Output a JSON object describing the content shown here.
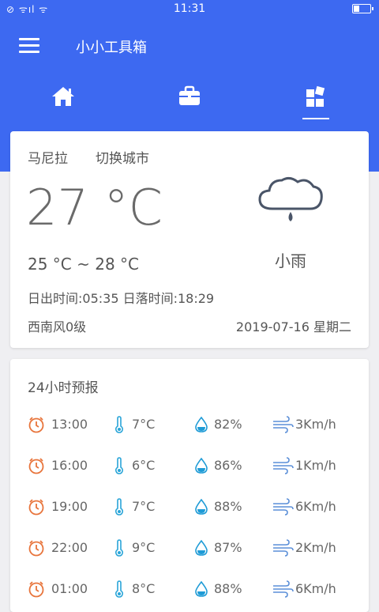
{
  "status_bar": {
    "time": "11:31",
    "left_icons": "⊘ ᯤıl ᯤ"
  },
  "app": {
    "title": "小小工具箱"
  },
  "tabs": [
    {
      "name": "home",
      "icon": "home-icon",
      "selected": false
    },
    {
      "name": "toolbox",
      "icon": "briefcase-icon",
      "selected": false
    },
    {
      "name": "widgets",
      "icon": "widgets-icon",
      "selected": true
    }
  ],
  "weather": {
    "city": "马尼拉",
    "switch_city": "切换城市",
    "temperature": "27 °C",
    "range": "25 °C ~ 28 °C",
    "sunrise_sunset": "日出时间:05:35 日落时间:18:29",
    "wind": "西南风0级",
    "date": "2019-07-16 星期二",
    "condition": "小雨",
    "condition_icon": "light-rain-cloud-icon"
  },
  "forecast": {
    "title": "24小时预报",
    "rows": [
      {
        "time": "13:00",
        "temp": "7°C",
        "humidity": "82%",
        "wind": "3Km/h"
      },
      {
        "time": "16:00",
        "temp": "6°C",
        "humidity": "86%",
        "wind": "1Km/h"
      },
      {
        "time": "19:00",
        "temp": "7°C",
        "humidity": "88%",
        "wind": "6Km/h"
      },
      {
        "time": "22:00",
        "temp": "9°C",
        "humidity": "87%",
        "wind": "2Km/h"
      },
      {
        "time": "01:00",
        "temp": "8°C",
        "humidity": "88%",
        "wind": "6Km/h"
      }
    ]
  },
  "colors": {
    "primary": "#3d69f1",
    "clock": "#e8743b",
    "thermo": "#2aa5d8",
    "drop": "#1e9bd6",
    "cloud": "#4a5568"
  }
}
